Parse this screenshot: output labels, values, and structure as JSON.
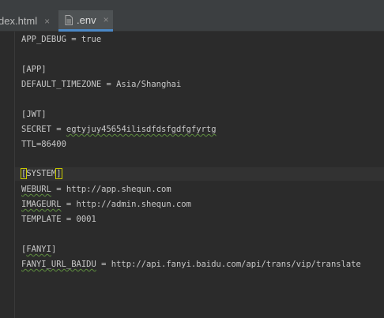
{
  "tabs": [
    {
      "label": "dex.html",
      "active": false,
      "close_icon": "×"
    },
    {
      "label": ".env",
      "active": true,
      "close_icon": "×"
    }
  ],
  "editor": {
    "lines": {
      "app_debug": "APP_DEBUG = true",
      "app_section": "[APP]",
      "default_timezone": "DEFAULT_TIMEZONE = Asia/Shanghai",
      "jwt_section": "[JWT]",
      "secret_key": "SECRET = ",
      "secret_value": "egtyjuy45654ilisdfdsfgdfgfyrtg",
      "ttl": "TTL=86400",
      "system_section_open": "[",
      "system_section_name": "SYSTEM",
      "system_section_close": "]",
      "weburl_key": "WEBURL",
      "weburl_rest": " = http://app.shequn.com",
      "imageurl_key": "IMAGEURL",
      "imageurl_rest": " = http://admin.shequn.com",
      "template": "TEMPLATE = 0001",
      "fanyi_section_open": "[",
      "fanyi_section_name": "FANYI",
      "fanyi_section_close": "]",
      "fanyi_url_key": "FANYI_URL_BAIDU",
      "fanyi_url_rest": " = http://api.fanyi.baidu.com/api/trans/vip/translate"
    }
  },
  "colors": {
    "editor_bg": "#2b2b2b",
    "tab_bar_bg": "#3c3f41",
    "active_tab_accent": "#4a88c7",
    "text": "#c8c8c8",
    "bracket_highlight": "#c9c900",
    "spellcheck_squiggle": "#5e8f3e"
  }
}
